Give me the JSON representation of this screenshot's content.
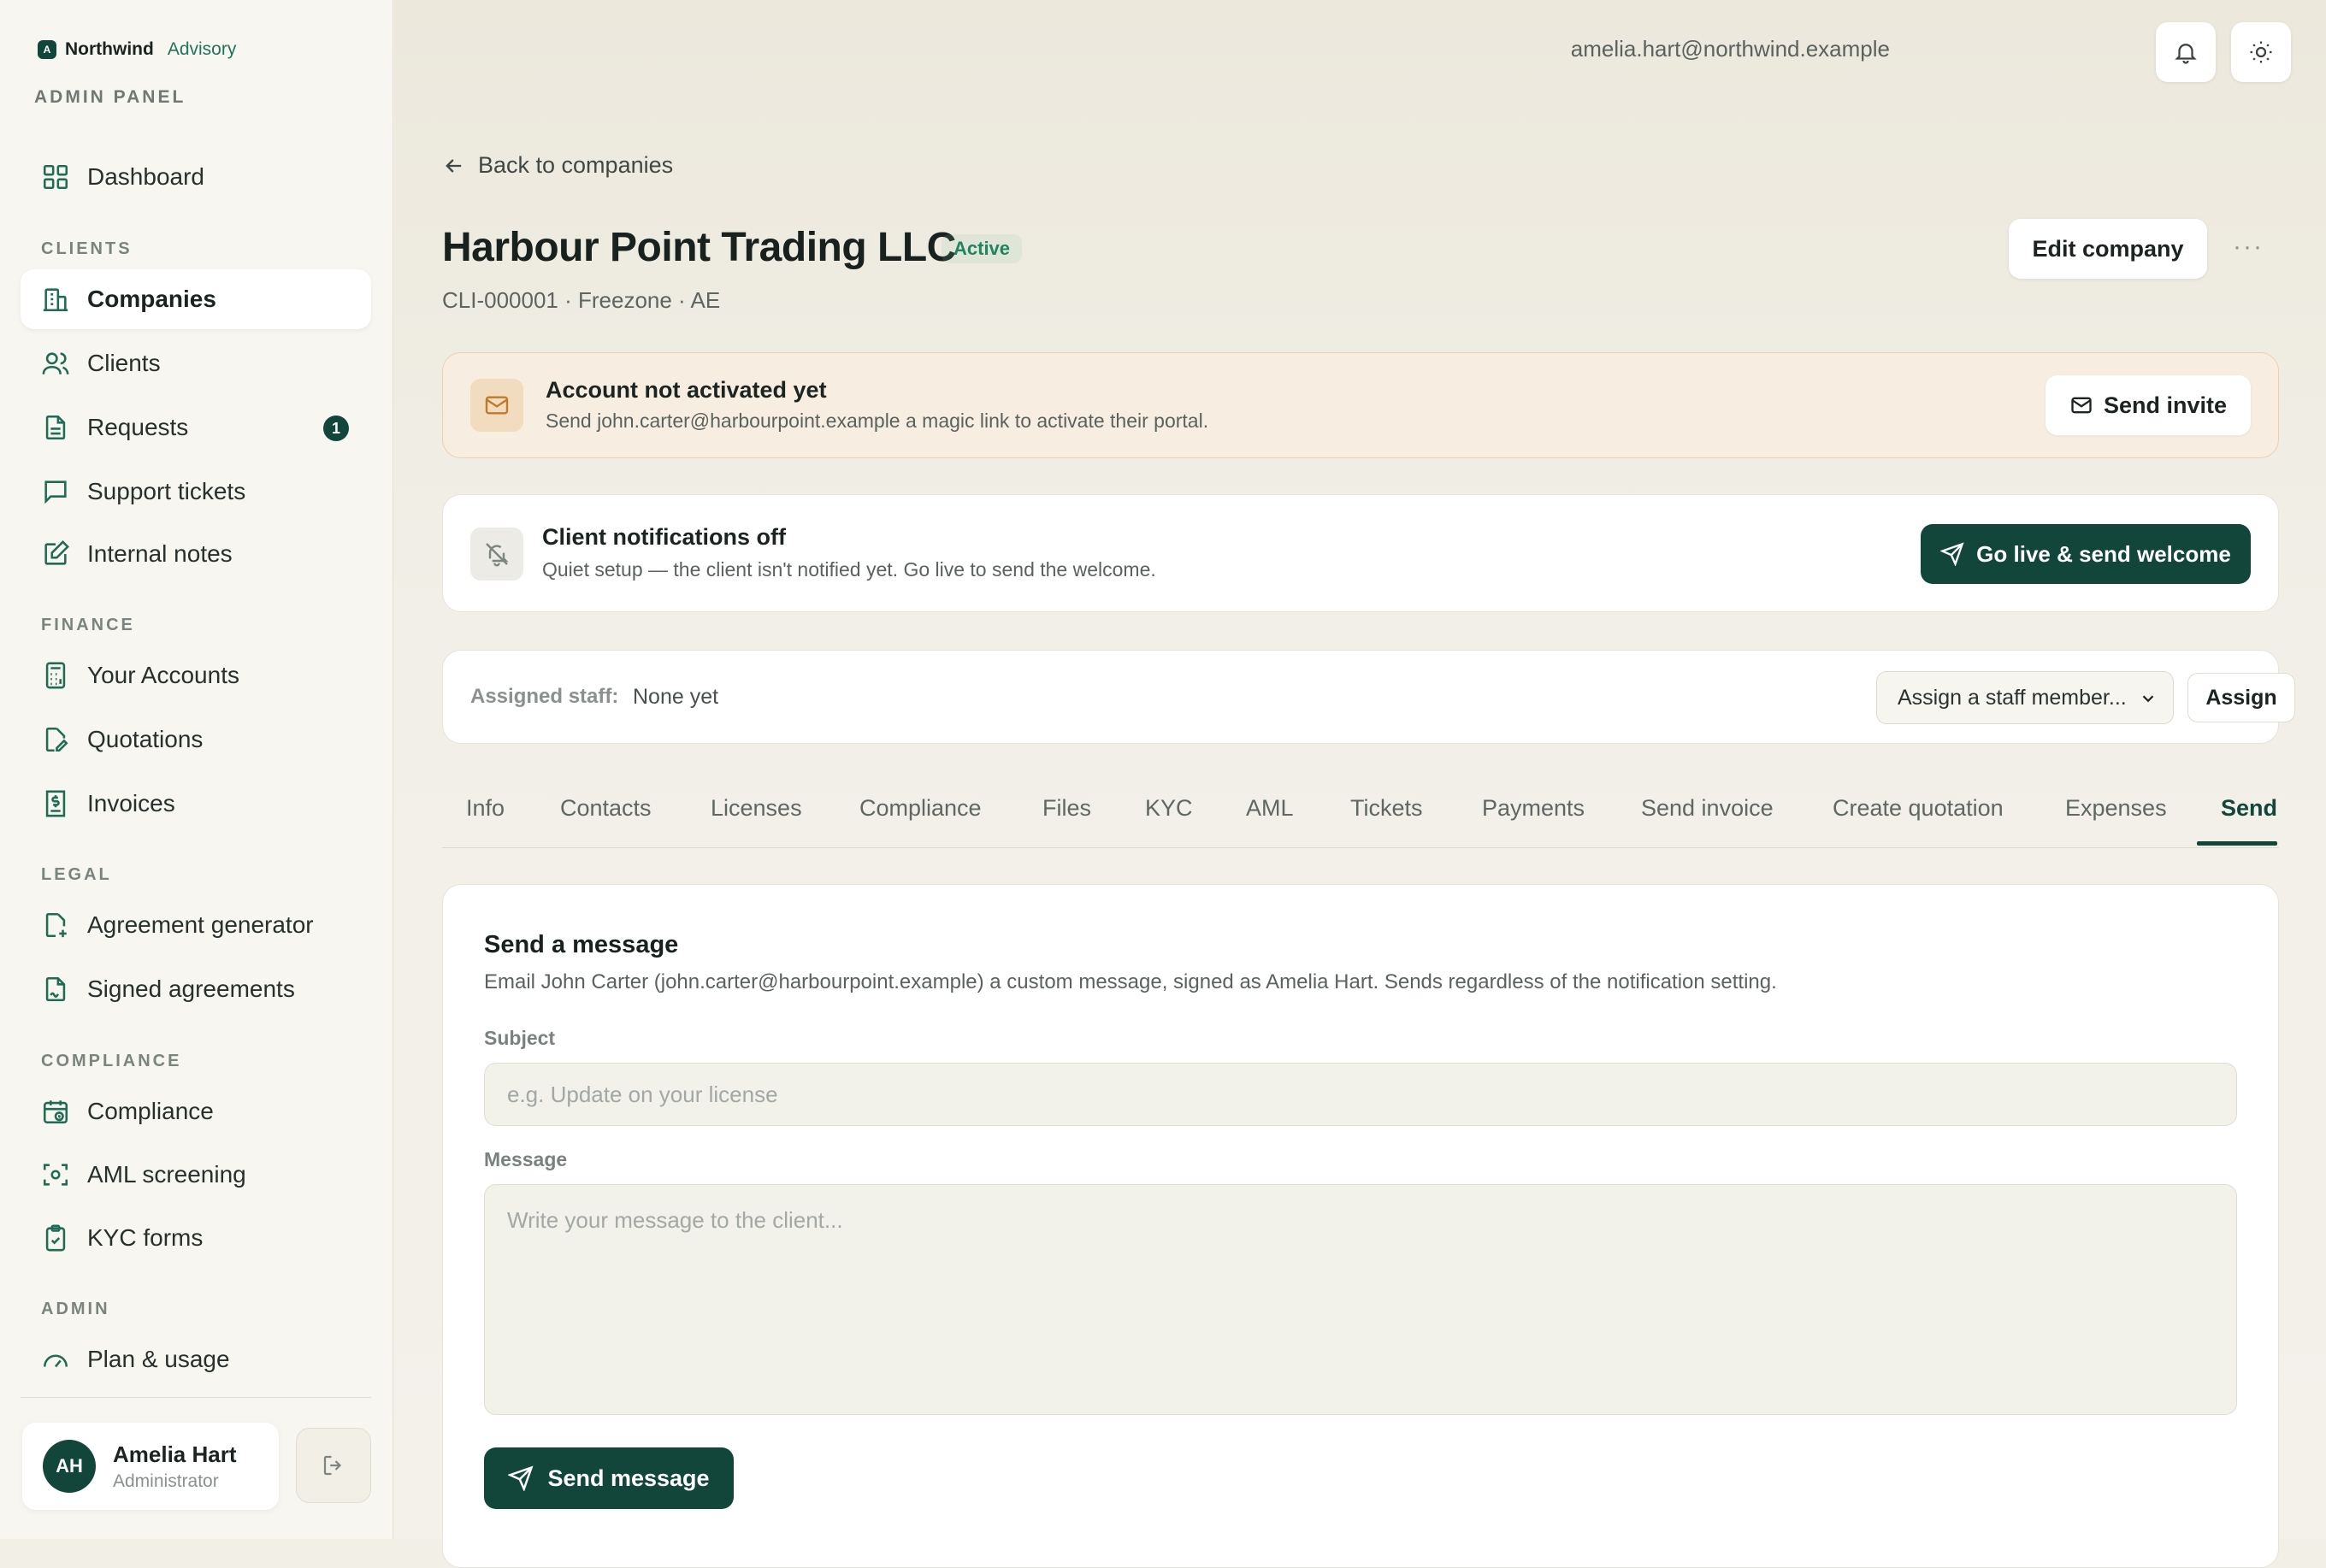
{
  "brand": {
    "name": "Northwind",
    "sub": "Advisory",
    "panel_label": "ADMIN PANEL"
  },
  "sidebar": {
    "dashboard": "Dashboard",
    "sections": {
      "clients": "CLIENTS",
      "finance": "FINANCE",
      "legal": "LEGAL",
      "compliance": "COMPLIANCE",
      "admin": "ADMIN"
    },
    "items": {
      "companies": "Companies",
      "clients": "Clients",
      "requests": "Requests",
      "requests_badge": "1",
      "support_tickets": "Support tickets",
      "internal_notes": "Internal notes",
      "your_accounts": "Your Accounts",
      "quotations": "Quotations",
      "invoices": "Invoices",
      "agreement_generator": "Agreement generator",
      "signed_agreements": "Signed agreements",
      "compliance": "Compliance",
      "aml_screening": "AML screening",
      "kyc_forms": "KYC forms",
      "plan_usage": "Plan & usage"
    },
    "user": {
      "initials": "AH",
      "name": "Amelia Hart",
      "role": "Administrator"
    }
  },
  "topbar": {
    "email": "amelia.hart@northwind.example"
  },
  "page": {
    "back": "Back to companies",
    "title": "Harbour Point Trading LLC",
    "status": "Active",
    "subtitle": "CLI-000001 · Freezone · AE",
    "edit_button": "Edit company",
    "more": "···"
  },
  "alert": {
    "title": "Account not activated yet",
    "text": "Send john.carter@harbourpoint.example a magic link to activate their portal.",
    "button": "Send invite"
  },
  "notifications": {
    "title": "Client notifications off",
    "text": "Quiet setup — the client isn't notified yet. Go live to send the welcome.",
    "button": "Go live & send welcome"
  },
  "staff": {
    "label": "Assigned staff:",
    "value": "None yet",
    "select_placeholder": "Assign a staff member...",
    "assign_button": "Assign"
  },
  "tabs": [
    "Info",
    "Contacts",
    "Licenses",
    "Compliance",
    "Files",
    "KYC",
    "AML",
    "Tickets",
    "Payments",
    "Send invoice",
    "Create quotation",
    "Expenses",
    "Send"
  ],
  "send_message": {
    "title": "Send a message",
    "description": "Email John Carter (john.carter@harbourpoint.example) a custom message, signed as Amelia Hart. Sends regardless of the notification setting.",
    "subject_label": "Subject",
    "subject_placeholder": "e.g. Update on your license",
    "message_label": "Message",
    "message_placeholder": "Write your message to the client...",
    "send_button": "Send message"
  },
  "colors": {
    "brand": "#12463b",
    "accent": "#23725e",
    "alert_bg": "#f7eee1",
    "status": "#23825f"
  },
  "icons": [
    "dashboard-icon",
    "building-icon",
    "users-icon",
    "document-icon",
    "chat-icon",
    "note-icon",
    "calculator-icon",
    "file-edit-icon",
    "receipt-icon",
    "file-plus-icon",
    "file-signature-icon",
    "calendar-check-icon",
    "scan-icon",
    "clipboard-icon",
    "gauge-icon",
    "logout-icon",
    "bell-icon",
    "sun-icon",
    "arrow-left-icon",
    "mail-icon",
    "bell-off-icon",
    "send-icon",
    "chevron-down-icon"
  ]
}
